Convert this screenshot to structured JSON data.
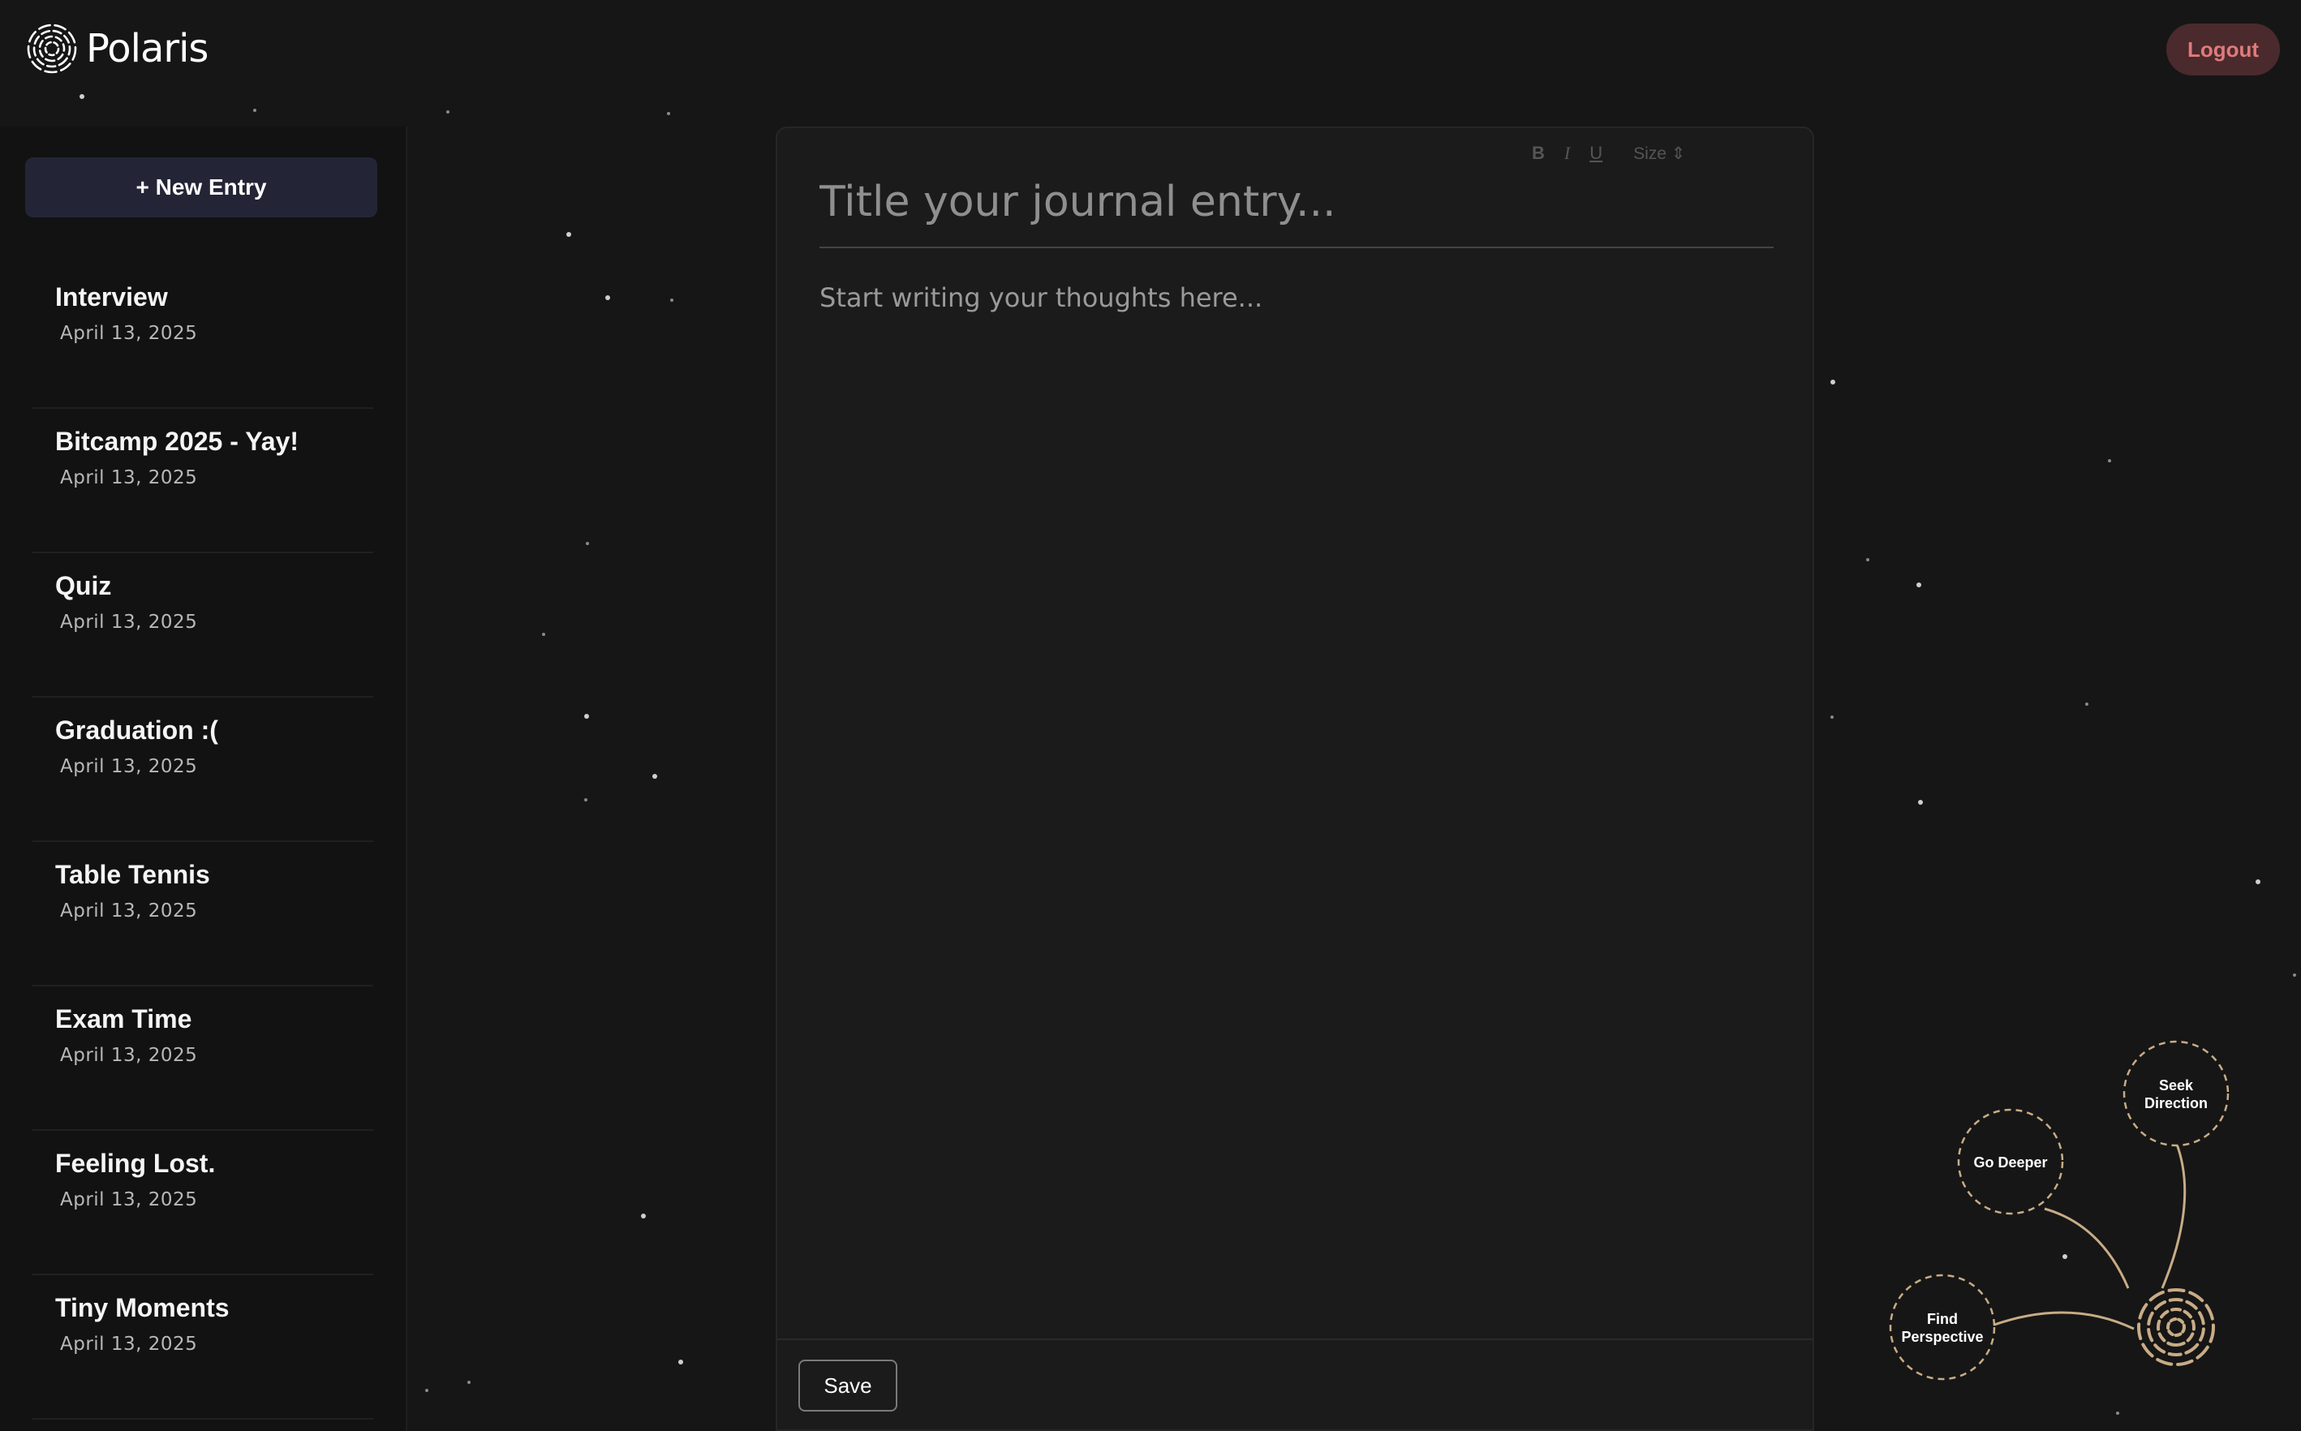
{
  "app": {
    "name": "Polaris",
    "logout_label": "Logout"
  },
  "sidebar": {
    "new_entry_label": "+ New Entry",
    "entries": [
      {
        "title": "Interview",
        "date": "April 13, 2025"
      },
      {
        "title": "Bitcamp 2025 - Yay!",
        "date": "April 13, 2025"
      },
      {
        "title": "Quiz",
        "date": "April 13, 2025"
      },
      {
        "title": "Graduation :(",
        "date": "April 13, 2025"
      },
      {
        "title": "Table Tennis",
        "date": "April 13, 2025"
      },
      {
        "title": "Exam Time",
        "date": "April 13, 2025"
      },
      {
        "title": "Feeling Lost.",
        "date": "April 13, 2025"
      },
      {
        "title": "Tiny Moments",
        "date": "April 13, 2025"
      }
    ]
  },
  "editor": {
    "toolbar": {
      "bold": "B",
      "italic": "I",
      "underline": "U",
      "size": "Size ⇕"
    },
    "title_placeholder": "Title your journal entry...",
    "body_placeholder": "Start writing your thoughts here...",
    "save_label": "Save"
  },
  "constellation": {
    "nodes": {
      "seek_direction": [
        "Seek",
        "Direction"
      ],
      "go_deeper": [
        "Go Deeper"
      ],
      "find_perspective": [
        "Find",
        "Perspective"
      ]
    },
    "accent_color": "#c8ac86"
  }
}
